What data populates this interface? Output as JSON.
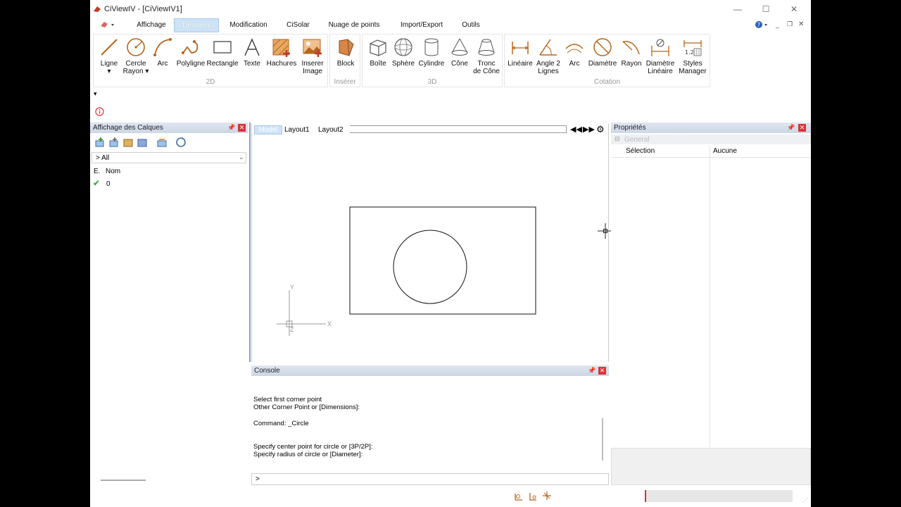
{
  "window": {
    "title": "CiViewIV - [CiViewIV1]",
    "controls": {
      "minimize": "—",
      "maximize": "☐",
      "close": "✕"
    }
  },
  "ribbon": {
    "tabs": [
      {
        "label": "Affichage"
      },
      {
        "label": "Dessiner",
        "active": true
      },
      {
        "label": "Modification"
      },
      {
        "label": "CiSolar"
      },
      {
        "label": "Nuage de points"
      },
      {
        "label": "Import/Export"
      },
      {
        "label": "Outils"
      }
    ],
    "groups": {
      "g2d": {
        "label": "2D",
        "buttons": [
          {
            "label": "Ligne",
            "sub": "▾",
            "icon": "line-icon"
          },
          {
            "label": "Cercle",
            "sub": "Rayon ▾",
            "icon": "circle-radius-icon"
          },
          {
            "label": "Arc",
            "icon": "arc-icon"
          },
          {
            "label": "Polyligne",
            "icon": "polyline-icon"
          },
          {
            "label": "Rectangle",
            "icon": "rectangle-icon"
          },
          {
            "label": "Texte",
            "icon": "text-icon"
          },
          {
            "label": "Hachures",
            "icon": "hatch-icon"
          },
          {
            "label": "Inserer",
            "sub": "Image",
            "icon": "insert-image-icon"
          }
        ]
      },
      "insert": {
        "label": "Insérer",
        "buttons": [
          {
            "label": "Block",
            "icon": "block-icon"
          }
        ]
      },
      "g3d": {
        "label": "3D",
        "buttons": [
          {
            "label": "Boîte",
            "icon": "box-icon"
          },
          {
            "label": "Sphère",
            "icon": "sphere-icon"
          },
          {
            "label": "Cylindre",
            "icon": "cylinder-icon"
          },
          {
            "label": "Cône",
            "icon": "cone-icon"
          },
          {
            "label": "Tronc",
            "sub": "de Cône",
            "icon": "truncated-cone-icon"
          }
        ]
      },
      "cotation": {
        "label": "Cotation",
        "buttons": [
          {
            "label": "Linéaire",
            "icon": "linear-dim-icon"
          },
          {
            "label": "Angle 2",
            "sub": "Lignes",
            "icon": "angle-dim-icon"
          },
          {
            "label": "Arc",
            "icon": "arc-dim-icon"
          },
          {
            "label": "Diamètre",
            "icon": "diameter-dim-icon"
          },
          {
            "label": "Rayon",
            "icon": "radius-dim-icon"
          },
          {
            "label": "Diamètre",
            "sub": "Linéaire",
            "icon": "linear-diameter-icon"
          },
          {
            "label": "Styles",
            "sub": "Manager",
            "icon": "styles-manager-icon"
          }
        ]
      }
    }
  },
  "layers_panel": {
    "title": "Affichage des Calques",
    "filter": "> All",
    "columns": {
      "state": "E.",
      "name": "Nom"
    },
    "rows": [
      {
        "checked": true,
        "name": "0"
      }
    ]
  },
  "canvas": {
    "tabs": [
      {
        "label": "Model",
        "active": true
      },
      {
        "label": "Layout1"
      },
      {
        "label": "Layout2"
      }
    ],
    "axis": {
      "y": "Y",
      "x": "X",
      "z": "Z"
    }
  },
  "console": {
    "title": "Console",
    "lines": [
      "Select first corner point",
      "Other Corner Point or [Dimensions]:",
      "",
      "Command: _Circle",
      "",
      "",
      "Specify center point for circle or [3P/2P]:",
      "Specify radius of circle or [Diameter]:"
    ],
    "prompt": ">"
  },
  "properties_panel": {
    "title": "Propriétés",
    "section": "General",
    "rows": [
      {
        "key": "Sélection",
        "value": "Aucune"
      }
    ]
  },
  "colors": {
    "accent": "#cfe3f6",
    "icon_brown": "#b5651d",
    "close_red": "#d9343a",
    "check_green": "#1f9a2a"
  }
}
